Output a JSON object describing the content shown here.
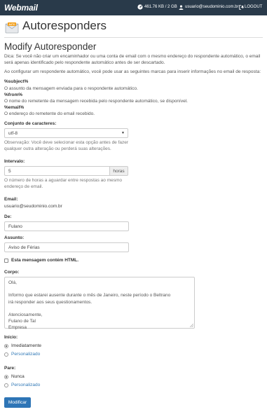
{
  "topbar": {
    "logo": "Webmail",
    "quota": "461.76 KB / 2 GB",
    "user": "usuario@seudominio.com.br",
    "logout": "LOGOUT"
  },
  "page": {
    "title": "Autoresponders"
  },
  "form": {
    "heading": "Modify Autoresponder",
    "tip1": "Dica: Se você não criar um encaminhador ou uma conta de email com o mesmo endereço do respondente automático, o email será apenas identificado pelo respondente automático antes de ser descartado.",
    "tip2": "Ao configurar um respondente automático, você pode usar as seguintes marcas para inserir informações no email de resposta:",
    "markers": [
      {
        "key": "%subject%",
        "desc": "O assunto da mensagem enviada para o respondente automático."
      },
      {
        "key": "%from%",
        "desc": "O nome do remetente da mensagem recebida pelo respondente automático, se disponível."
      },
      {
        "key": "%email%",
        "desc": "O endereço do remetente do email recebido."
      }
    ],
    "charset": {
      "label": "Conjunto de caracteres:",
      "value": "utf-8",
      "note": "Observação: Você deve selecionar esta opção antes de fazer qualquer outra alteração ou perderá suas alterações."
    },
    "interval": {
      "label": "Intervalo:",
      "value": "5",
      "unit": "horas",
      "help": "O número de horas a aguardar entre respostas ao mesmo endereço de email."
    },
    "email": {
      "label": "Email:",
      "value": "usuario@seudominio.com.br"
    },
    "from": {
      "label": "De:",
      "value": "Fulano"
    },
    "subject": {
      "label": "Assunto:",
      "value": "Aviso de Férias"
    },
    "html_checkbox": {
      "label": "Esta mensagem contém HTML.",
      "checked": false
    },
    "body": {
      "label": "Corpo:",
      "lines": [
        "Olá,",
        "",
        "Informo que estarei ausente durante o mês de Janeiro, neste período o Beltrano",
        "irá responder aos seus questionamentos.",
        "",
        "Atenciosamente,",
        "Fulano de Tal",
        "Empresa"
      ]
    },
    "start": {
      "label": "Início:",
      "options": [
        "Imediatamente",
        "Personalizado"
      ],
      "selected": 0
    },
    "stop": {
      "label": "Pare:",
      "options": [
        "Nunca",
        "Personalizado"
      ],
      "selected": 0
    },
    "submit_label": "Modificar"
  },
  "colors": {
    "topbar": "#293a4a",
    "primary": "#2e75b6",
    "link": "#337ab7"
  },
  "icons": [
    "gauge-icon",
    "user-icon",
    "logout-icon",
    "autoresponder-envelope-icon"
  ]
}
